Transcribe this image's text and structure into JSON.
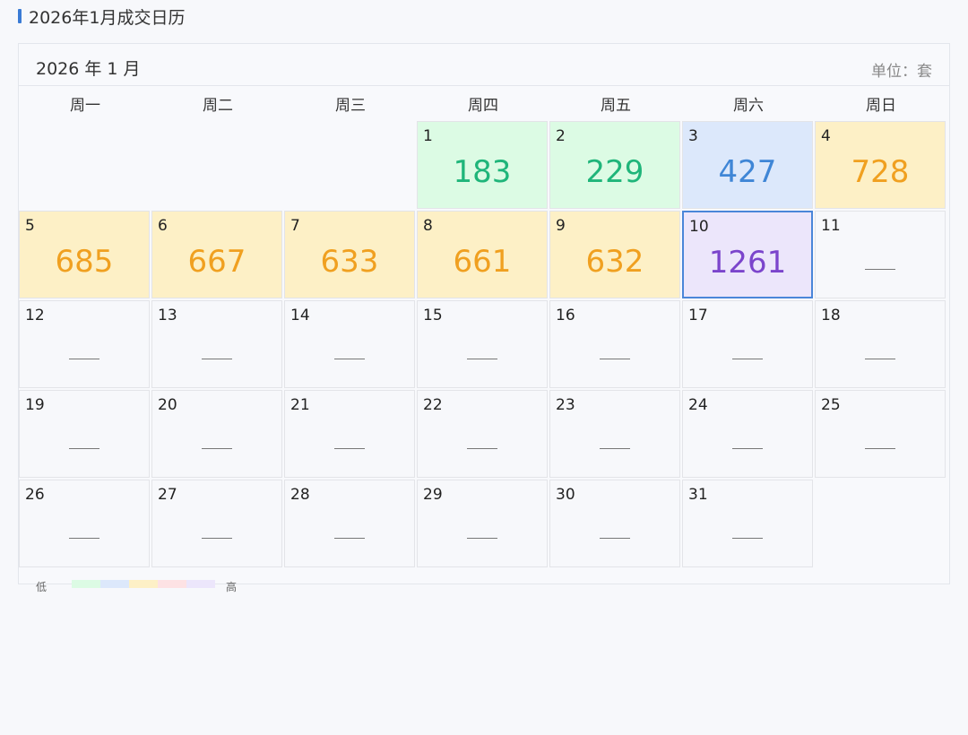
{
  "page": {
    "title": "2026年1月成交日历"
  },
  "calendar": {
    "month_label": "2026 年 1 月",
    "unit": "单位：套",
    "weekdays": [
      "周一",
      "周二",
      "周三",
      "周四",
      "周五",
      "周六",
      "周日"
    ],
    "days": [
      {
        "day": "1",
        "value": "183",
        "level": "green"
      },
      {
        "day": "2",
        "value": "229",
        "level": "green"
      },
      {
        "day": "3",
        "value": "427",
        "level": "blue"
      },
      {
        "day": "4",
        "value": "728",
        "level": "yellow"
      },
      {
        "day": "5",
        "value": "685",
        "level": "yellow"
      },
      {
        "day": "6",
        "value": "667",
        "level": "yellow"
      },
      {
        "day": "7",
        "value": "633",
        "level": "yellow"
      },
      {
        "day": "8",
        "value": "661",
        "level": "yellow"
      },
      {
        "day": "9",
        "value": "632",
        "level": "yellow"
      },
      {
        "day": "10",
        "value": "1261",
        "level": "purple",
        "selected": true
      },
      {
        "day": "11",
        "value": null
      },
      {
        "day": "12",
        "value": null
      },
      {
        "day": "13",
        "value": null
      },
      {
        "day": "14",
        "value": null
      },
      {
        "day": "15",
        "value": null
      },
      {
        "day": "16",
        "value": null
      },
      {
        "day": "17",
        "value": null
      },
      {
        "day": "18",
        "value": null
      },
      {
        "day": "19",
        "value": null
      },
      {
        "day": "20",
        "value": null
      },
      {
        "day": "21",
        "value": null
      },
      {
        "day": "22",
        "value": null
      },
      {
        "day": "23",
        "value": null
      },
      {
        "day": "24",
        "value": null
      },
      {
        "day": "25",
        "value": null
      },
      {
        "day": "26",
        "value": null
      },
      {
        "day": "27",
        "value": null
      },
      {
        "day": "28",
        "value": null
      },
      {
        "day": "29",
        "value": null
      },
      {
        "day": "30",
        "value": null
      },
      {
        "day": "31",
        "value": null
      }
    ]
  },
  "legend": {
    "low": "低",
    "high": "高",
    "colors": [
      "#dcfbe4",
      "#dce8fb",
      "#fdf0c6",
      "#fde2e4",
      "#ece6fb"
    ]
  },
  "colors": {
    "accent": "#3a7bd5",
    "green": "#1fb57a",
    "blue": "#3f86d6",
    "yellow": "#f0a020",
    "purple": "#7b45cc"
  }
}
